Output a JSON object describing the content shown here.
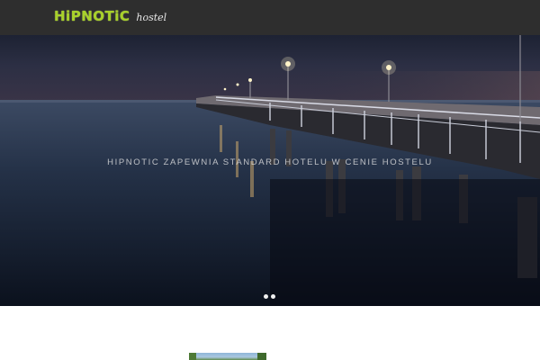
{
  "header": {
    "logo_main": "HiPNOTiC",
    "logo_sub": "hostel"
  },
  "hero": {
    "caption": "HIPNOTIC ZAPEWNIA STANDARD HOTELU W CENIE HOSTELU",
    "slide_count": 2,
    "active_slide": 1
  },
  "colors": {
    "header_bg": "#2e2e2e",
    "logo_green": "#a8d12a"
  }
}
